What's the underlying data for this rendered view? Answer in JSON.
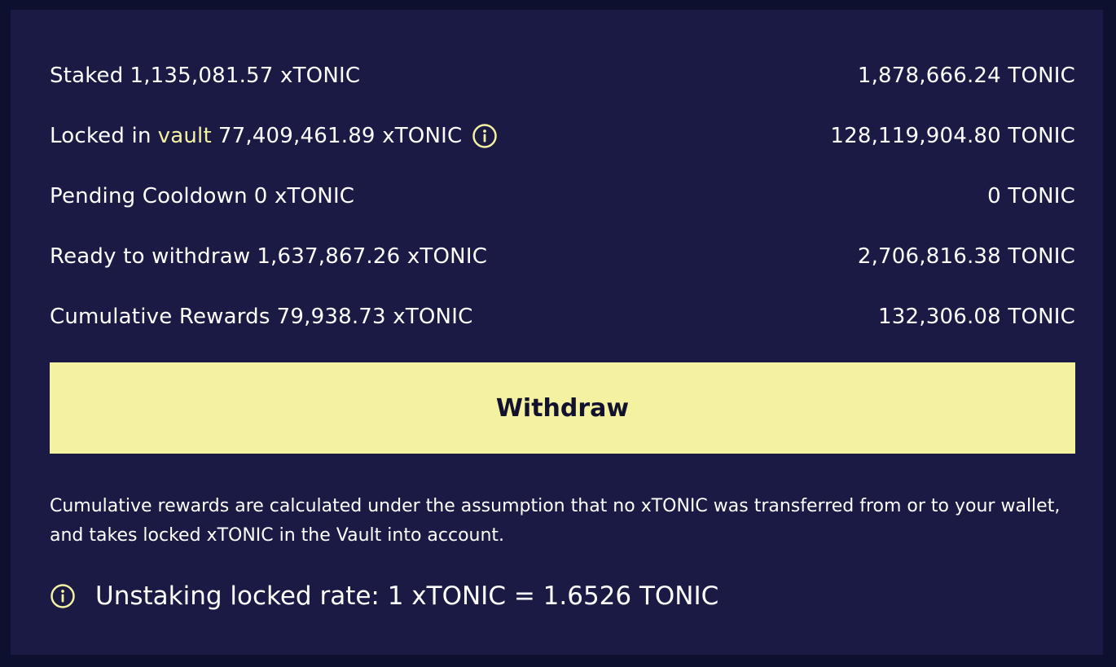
{
  "rows": [
    {
      "label": "Staked",
      "amount": "1,135,081.57 xTONIC",
      "value": "1,878,666.24 TONIC"
    },
    {
      "label": "Locked in",
      "link": "vault",
      "amount": "77,409,461.89 xTONIC",
      "value": "128,119,904.80 TONIC",
      "icon": "info-icon"
    },
    {
      "label": "Pending Cooldown",
      "amount": "0 xTONIC",
      "value": "0 TONIC"
    },
    {
      "label": "Ready to withdraw",
      "amount": "1,637,867.26 xTONIC",
      "value": "2,706,816.38 TONIC"
    },
    {
      "label": "Cumulative Rewards",
      "amount": "79,938.73 xTONIC",
      "value": "132,306.08 TONIC"
    }
  ],
  "withdraw_label": "Withdraw",
  "note": "Cumulative rewards are calculated under the assumption that no xTONIC was transferred from or to your wallet, and takes locked xTONIC in the Vault into account.",
  "rate": {
    "icon": "info-icon",
    "text": "Unstaking locked rate: 1 xTONIC = 1.6526 TONIC"
  },
  "colors": {
    "background": "#0e1030",
    "panel": "#1b1a44",
    "accent": "#f4f2a0",
    "button_text": "#12122e",
    "text": "#ffffff"
  }
}
